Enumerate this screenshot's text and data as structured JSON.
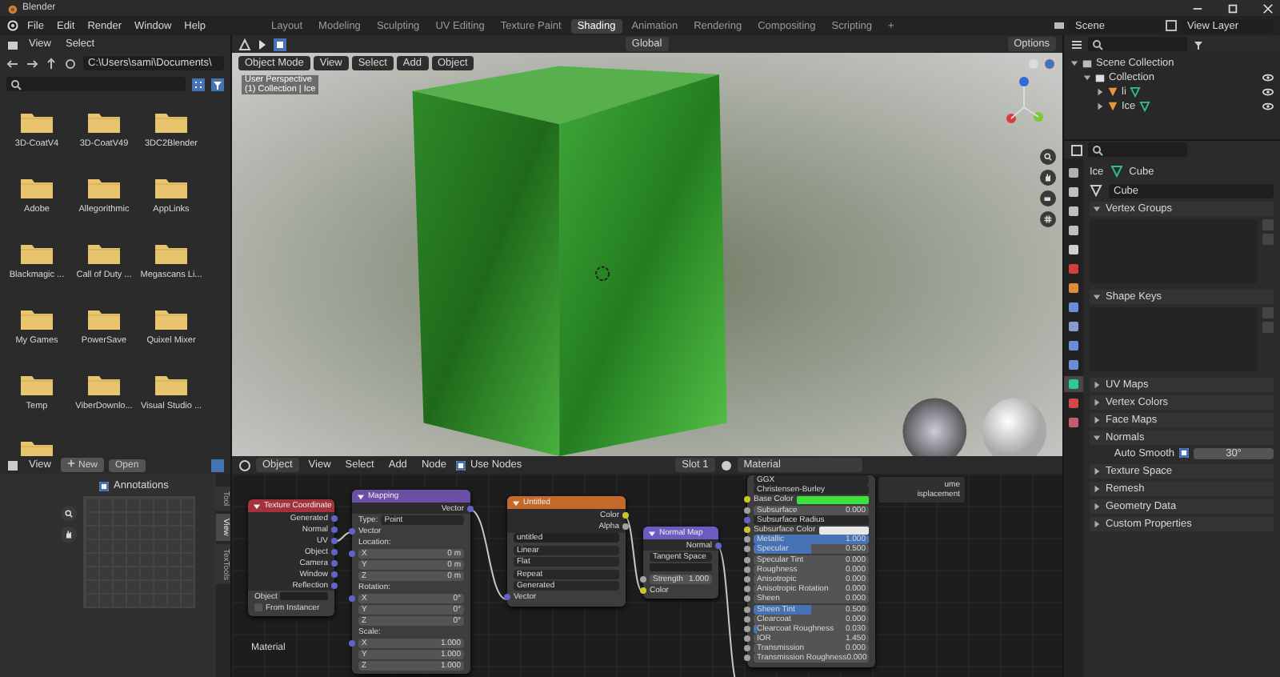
{
  "window": {
    "title": "Blender"
  },
  "menu": [
    "File",
    "Edit",
    "Render",
    "Window",
    "Help"
  ],
  "workspaces": [
    {
      "label": "Layout",
      "selected": false
    },
    {
      "label": "Modeling",
      "selected": false
    },
    {
      "label": "Sculpting",
      "selected": false
    },
    {
      "label": "UV Editing",
      "selected": false
    },
    {
      "label": "Texture Paint",
      "selected": false
    },
    {
      "label": "Shading",
      "selected": true
    },
    {
      "label": "Animation",
      "selected": false
    },
    {
      "label": "Rendering",
      "selected": false
    },
    {
      "label": "Compositing",
      "selected": false
    },
    {
      "label": "Scripting",
      "selected": false
    }
  ],
  "add_workspace": "+",
  "scene": "Scene",
  "view_layer": "View Layer",
  "file_browser": {
    "menu": [
      "View",
      "Select"
    ],
    "path": "C:\\Users\\sami\\Documents\\",
    "folders": [
      {
        "kind": "folder",
        "name": "3D-CoatV4"
      },
      {
        "kind": "folder",
        "name": "3D-CoatV49"
      },
      {
        "kind": "folder",
        "name": "3DC2Blender"
      },
      {
        "kind": "folder",
        "name": "Adobe"
      },
      {
        "kind": "folder",
        "name": "Allegorithmic"
      },
      {
        "kind": "folder",
        "name": "AppLinks"
      },
      {
        "kind": "folder",
        "name": "Blackmagic ..."
      },
      {
        "kind": "folder",
        "name": "Call of Duty ..."
      },
      {
        "kind": "folder",
        "name": "Megascans Li..."
      },
      {
        "kind": "folder",
        "name": "My Games"
      },
      {
        "kind": "folder",
        "name": "PowerSave"
      },
      {
        "kind": "folder",
        "name": "Quixel Mixer"
      },
      {
        "kind": "folder",
        "name": "Temp"
      },
      {
        "kind": "folder",
        "name": "ViberDownlo..."
      },
      {
        "kind": "folder",
        "name": "Visual Studio ..."
      },
      {
        "kind": "cut"
      }
    ]
  },
  "image_editor": {
    "menu": [
      "View"
    ],
    "new": "New",
    "open": "Open",
    "annotations": {
      "label": "Annotations",
      "checked": true
    },
    "side_tabs": [
      {
        "label": "Tool",
        "selected": false
      },
      {
        "label": "View",
        "selected": true
      },
      {
        "label": "TexTools",
        "selected": false
      }
    ]
  },
  "viewport": {
    "transform": "Global",
    "options": "Options",
    "mode": "Object Mode",
    "menu": [
      "View",
      "Select",
      "Add",
      "Object"
    ],
    "overlay": [
      "User Perspective",
      "(1) Collection | Ice"
    ]
  },
  "outliner": {
    "tree": [
      {
        "label": "Scene Collection",
        "kind": "scene",
        "expanded": true,
        "children": [
          {
            "label": "Collection",
            "kind": "collection",
            "expanded": true,
            "children": [
              {
                "label": "li",
                "kind": "object",
                "expanded": false
              },
              {
                "label": "Ice",
                "kind": "object",
                "expanded": false
              }
            ]
          }
        ]
      }
    ]
  },
  "properties": {
    "tabs": [
      {
        "color": "#b0b0b0",
        "selected": false
      },
      {
        "color": "#c0c0c0",
        "selected": false
      },
      {
        "color": "#c0c0c0",
        "selected": false
      },
      {
        "color": "#c0c0c0",
        "selected": false
      },
      {
        "color": "#d0d0d0",
        "selected": false
      },
      {
        "color": "#d04040",
        "selected": false
      },
      {
        "color": "#e08a3c",
        "selected": false
      },
      {
        "color": "#6b8ed6",
        "selected": false
      },
      {
        "color": "#8a9ad0",
        "selected": false
      },
      {
        "color": "#6b8ed6",
        "selected": false
      },
      {
        "color": "#6b8ed6",
        "selected": false
      },
      {
        "color": "#33c4a0",
        "selected": true
      },
      {
        "color": "#d04a4a",
        "selected": false
      },
      {
        "color": "#c85a70",
        "selected": false
      }
    ],
    "breadcrumb": [
      "Ice",
      "Cube"
    ],
    "mesh_name": "Cube",
    "panels": [
      {
        "label": "Vertex Groups",
        "kind": "list",
        "expanded": true
      },
      {
        "label": "Shape Keys",
        "kind": "list",
        "expanded": true
      },
      {
        "label": "UV Maps",
        "expanded": false
      },
      {
        "label": "Vertex Colors",
        "expanded": false
      },
      {
        "label": "Face Maps",
        "expanded": false
      },
      {
        "label": "Normals",
        "kind": "normals",
        "expanded": true,
        "auto_smooth": {
          "label": "Auto Smooth",
          "checked": true,
          "angle": "30°"
        }
      },
      {
        "label": "Texture Space",
        "expanded": false
      },
      {
        "label": "Remesh",
        "expanded": false
      },
      {
        "label": "Geometry Data",
        "expanded": false
      },
      {
        "label": "Custom Properties",
        "expanded": false
      }
    ]
  },
  "node_editor": {
    "object": "Object",
    "menu": [
      "View",
      "Select",
      "Add",
      "Node"
    ],
    "use_nodes": {
      "label": "Use Nodes",
      "checked": true
    },
    "slot": "Slot 1",
    "material": "Material",
    "frame_label": "Material",
    "output_fragment": [
      "ume",
      "isplacement"
    ],
    "nodes": [
      {
        "title": "Texture Coordinate",
        "color": "#a3323a",
        "rows": [
          {
            "kind": "output",
            "label": "Generated",
            "socket": {
              "color": "#6363c7"
            }
          },
          {
            "kind": "output",
            "label": "Normal",
            "socket": {
              "color": "#6363c7"
            }
          },
          {
            "kind": "output",
            "label": "UV",
            "socket": {
              "color": "#6363c7"
            }
          },
          {
            "kind": "output",
            "label": "Object",
            "socket": {
              "color": "#6363c7"
            }
          },
          {
            "kind": "output",
            "label": "Camera",
            "socket": {
              "color": "#6363c7"
            }
          },
          {
            "kind": "output",
            "label": "Window",
            "socket": {
              "color": "#6363c7"
            }
          },
          {
            "kind": "output",
            "label": "Reflection",
            "socket": {
              "color": "#6363c7"
            }
          },
          {
            "kind": "object_field",
            "label": "Object"
          },
          {
            "kind": "checkbox",
            "label": "From Instancer",
            "checked": false
          }
        ]
      },
      {
        "title": "Mapping",
        "color": "#6b4fa3",
        "rows": [
          {
            "kind": "output",
            "label": "Vector",
            "socket": {
              "color": "#6363c7"
            }
          },
          {
            "kind": "dropdown",
            "label": "Type:",
            "value": "Point"
          },
          {
            "kind": "input",
            "label": "Vector",
            "socket": {
              "color": "#6363c7"
            }
          },
          {
            "kind": "label",
            "label": "Location:"
          },
          {
            "kind": "field",
            "label": "X",
            "value": "0 m",
            "socket": {
              "color": "#6363c7"
            }
          },
          {
            "kind": "field",
            "label": "Y",
            "value": "0 m"
          },
          {
            "kind": "field",
            "label": "Z",
            "value": "0 m"
          },
          {
            "kind": "label",
            "label": "Rotation:"
          },
          {
            "kind": "field",
            "label": "X",
            "value": "0°",
            "socket": {
              "color": "#6363c7"
            }
          },
          {
            "kind": "field",
            "label": "Y",
            "value": "0°"
          },
          {
            "kind": "field",
            "label": "Z",
            "value": "0°"
          },
          {
            "kind": "label",
            "label": "Scale:"
          },
          {
            "kind": "field",
            "label": "X",
            "value": "1.000",
            "socket": {
              "color": "#6363c7"
            }
          },
          {
            "kind": "field",
            "label": "Y",
            "value": "1.000"
          },
          {
            "kind": "field",
            "label": "Z",
            "value": "1.000"
          }
        ]
      },
      {
        "title": "Untitled",
        "color": "#c4692c",
        "rows": [
          {
            "kind": "output",
            "label": "Color",
            "socket": {
              "color": "#c7c729"
            }
          },
          {
            "kind": "output",
            "label": "Alpha",
            "socket": {
              "color": "#a1a1a1"
            }
          },
          {
            "kind": "image",
            "value": "untitled"
          },
          {
            "kind": "dropdown",
            "value": "Linear"
          },
          {
            "kind": "dropdown",
            "value": "Flat"
          },
          {
            "kind": "dropdown",
            "value": "Repeat"
          },
          {
            "kind": "dropdown",
            "value": "Generated"
          },
          {
            "kind": "input",
            "label": "Vector",
            "socket": {
              "color": "#6363c7"
            }
          }
        ]
      },
      {
        "title": "Normal Map",
        "color": "#6a5cc0",
        "rows": [
          {
            "kind": "output",
            "label": "Normal",
            "socket": {
              "color": "#6363c7"
            }
          },
          {
            "kind": "dropdown",
            "value": "Tangent Space"
          },
          {
            "kind": "uvfield"
          },
          {
            "kind": "field",
            "label": "Strength",
            "value": "1.000",
            "socket": {
              "color": "#a1a1a1"
            }
          },
          {
            "kind": "input",
            "label": "Color",
            "socket": {
              "color": "#c7c729"
            }
          }
        ]
      },
      {
        "rows": [
          {
            "kind": "dropdown",
            "value": "GGX"
          },
          {
            "kind": "dropdown",
            "value": "Christensen-Burley"
          },
          {
            "kind": "color",
            "label": "Base Color",
            "color": "#3ee23e",
            "socket": {
              "color": "#c7c729"
            }
          },
          {
            "kind": "slider",
            "label": "Subsurface",
            "value": "0.000",
            "level": 0,
            "socket": {
              "color": "#a1a1a1"
            }
          },
          {
            "kind": "dropdown",
            "value": "Subsurface Radius",
            "socket": {
              "color": "#6363c7"
            }
          },
          {
            "kind": "color",
            "label": "Subsurface Color",
            "color": "#e8e8e8",
            "socket": {
              "color": "#c7c729"
            }
          },
          {
            "kind": "slider",
            "label": "Metallic",
            "value": "1.000",
            "level": 1,
            "socket": {
              "color": "#a1a1a1"
            }
          },
          {
            "kind": "slider",
            "label": "Specular",
            "value": "0.500",
            "level": 0.5,
            "socket": {
              "color": "#a1a1a1"
            }
          },
          {
            "kind": "slider",
            "label": "Specular Tint",
            "value": "0.000",
            "level": 0,
            "socket": {
              "color": "#a1a1a1"
            }
          },
          {
            "kind": "slider",
            "label": "Roughness",
            "value": "0.000",
            "level": 0,
            "socket": {
              "color": "#a1a1a1"
            }
          },
          {
            "kind": "slider",
            "label": "Anisotropic",
            "value": "0.000",
            "level": 0,
            "socket": {
              "color": "#a1a1a1"
            }
          },
          {
            "kind": "slider",
            "label": "Anisotropic Rotation",
            "value": "0.000",
            "level": 0,
            "socket": {
              "color": "#a1a1a1"
            }
          },
          {
            "kind": "slider",
            "label": "Sheen",
            "value": "0.000",
            "level": 0,
            "socket": {
              "color": "#a1a1a1"
            }
          },
          {
            "kind": "slider",
            "label": "Sheen Tint",
            "value": "0.500",
            "level": 0.5,
            "socket": {
              "color": "#a1a1a1"
            }
          },
          {
            "kind": "slider",
            "label": "Clearcoat",
            "value": "0.000",
            "level": 0,
            "socket": {
              "color": "#a1a1a1"
            }
          },
          {
            "kind": "slider",
            "label": "Clearcoat Roughness",
            "value": "0.030",
            "level": 0.03,
            "socket": {
              "color": "#a1a1a1"
            }
          },
          {
            "kind": "field",
            "label": "IOR",
            "value": "1.450",
            "socket": {
              "color": "#a1a1a1"
            }
          },
          {
            "kind": "slider",
            "label": "Transmission",
            "value": "0.000",
            "level": 0,
            "socket": {
              "color": "#a1a1a1"
            }
          },
          {
            "kind": "slider",
            "label": "Transmission Roughness",
            "value": "0.000",
            "level": 0,
            "socket": {
              "color": "#a1a1a1"
            }
          }
        ]
      }
    ]
  }
}
